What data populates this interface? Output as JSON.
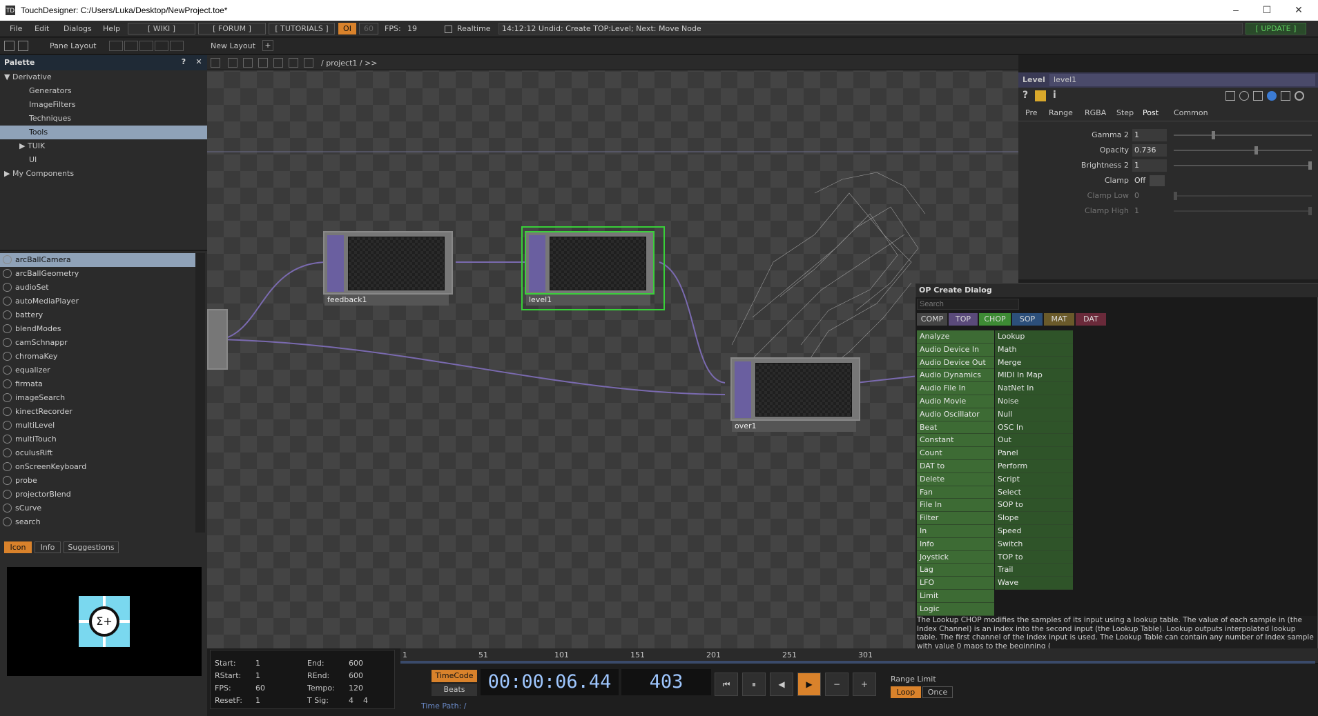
{
  "window": {
    "title": "TouchDesigner: C:/Users/Luka/Desktop/NewProject.toe*",
    "logo_text": "TD",
    "min": "–",
    "max": "☐",
    "close": "✕"
  },
  "menubar": {
    "items": [
      "File",
      "Edit",
      "Dialogs",
      "Help"
    ],
    "wiki": "[ WIKI ]",
    "forum": "[ FORUM ]",
    "tutorials": "[ TUTORIALS ]",
    "oi": "OI",
    "fps_target": "60",
    "fps_label": "FPS:",
    "fps_value": "19",
    "realtime": "Realtime",
    "status": "14:12:12 Undid: Create TOP:Level; Next: Move Node",
    "update": "[ UPDATE ]"
  },
  "toolbar": {
    "pane_layout": "Pane Layout",
    "new_layout": "New Layout",
    "plus": "+"
  },
  "palette": {
    "title": "Palette",
    "help": "?",
    "close": "✕",
    "tree": [
      {
        "label": "Derivative",
        "arrow": "▼"
      },
      {
        "label": "Generators"
      },
      {
        "label": "ImageFilters"
      },
      {
        "label": "Techniques"
      },
      {
        "label": "Tools"
      },
      {
        "label": "TUIK",
        "arrow": "▶"
      },
      {
        "label": "UI"
      },
      {
        "label": "My Components",
        "arrow": "▶"
      }
    ],
    "tools": [
      "arcBallCamera",
      "arcBallGeometry",
      "audioSet",
      "autoMediaPlayer",
      "battery",
      "blendModes",
      "camSchnappr",
      "chromaKey",
      "equalizer",
      "firmata",
      "imageSearch",
      "kinectRecorder",
      "multiLevel",
      "multiTouch",
      "oculusRift",
      "onScreenKeyboard",
      "probe",
      "projectorBlend",
      "sCurve",
      "search"
    ],
    "bottom_tabs": [
      "Icon",
      "Info",
      "Suggestions"
    ],
    "icon_glyph": "Σ+"
  },
  "network": {
    "path": "/ project1 / >>",
    "nodes": [
      {
        "name": "feedback1"
      },
      {
        "name": "level1"
      },
      {
        "name": "over1"
      }
    ]
  },
  "params": {
    "type": "Level",
    "name": "level1",
    "help": "?",
    "info": "i",
    "tabs": [
      "Pre",
      "Range",
      "RGBA",
      "Step",
      "Post",
      "Common"
    ],
    "active_tab": "Post",
    "rows": [
      {
        "label": "Gamma 2",
        "value": "1"
      },
      {
        "label": "Opacity",
        "value": "0.736"
      },
      {
        "label": "Brightness 2",
        "value": "1"
      },
      {
        "label": "Clamp",
        "value": "Off"
      },
      {
        "label": "Clamp Low",
        "value": "0"
      },
      {
        "label": "Clamp High",
        "value": "1"
      }
    ],
    "knob_levels": [
      0.28,
      0.6,
      1.0,
      null,
      0.0,
      1.0
    ]
  },
  "op_dialog": {
    "title": "OP Create Dialog",
    "search_placeholder": "Search",
    "tabs": [
      "COMP",
      "TOP",
      "CHOP",
      "SOP",
      "MAT",
      "DAT"
    ],
    "active_tab": "CHOP",
    "col_a": [
      "Analyze",
      "Audio Device In",
      "Audio Device Out",
      "Audio Dynamics",
      "Audio File In",
      "Audio Movie",
      "Audio Oscillator",
      "Beat",
      "Constant",
      "Count",
      "DAT to",
      "Delete",
      "Fan",
      "File In",
      "Filter",
      "In",
      "Info",
      "Joystick",
      "Lag",
      "LFO",
      "Limit",
      "Logic"
    ],
    "col_b": [
      "Lookup",
      "Math",
      "Merge",
      "MIDI In Map",
      "NatNet In",
      "Noise",
      "Null",
      "OSC In",
      "Out",
      "Panel",
      "Perform",
      "Script",
      "Select",
      "SOP to",
      "Slope",
      "Speed",
      "Switch",
      "TOP to",
      "Trail",
      "Wave"
    ],
    "description": "The Lookup CHOP modifies the samples of its input using a lookup table. The value of each sample in (the Index Channel) is an index into the second input (the Lookup Table). Lookup outputs interpolated lookup table. The first channel of the Index input is used. The Lookup Table can contain any number of Index sample with value 0 maps to the beginning ("
  },
  "timeline": {
    "ruler_ticks": [
      "1",
      "51",
      "101",
      "151",
      "201",
      "251",
      "301"
    ],
    "info": [
      {
        "k": "Start:",
        "v": "1"
      },
      {
        "k": "End:",
        "v": "600"
      },
      {
        "k": "RStart:",
        "v": "1"
      },
      {
        "k": "REnd:",
        "v": "600"
      },
      {
        "k": "FPS:",
        "v": "60"
      },
      {
        "k": "Tempo:",
        "v": "120"
      },
      {
        "k": "ResetF:",
        "v": "1"
      },
      {
        "k": "T Sig:",
        "v": "4    4"
      }
    ],
    "timecode_btn": "TimeCode",
    "beats_btn": "Beats",
    "timecode": "00:00:06.44",
    "frame": "403",
    "range_limit": "Range Limit",
    "loop": "Loop",
    "once": "Once",
    "time_path": "Time Path: /",
    "transport": [
      "⏮",
      "⏸",
      "◀",
      "▶",
      "−",
      "+"
    ]
  }
}
